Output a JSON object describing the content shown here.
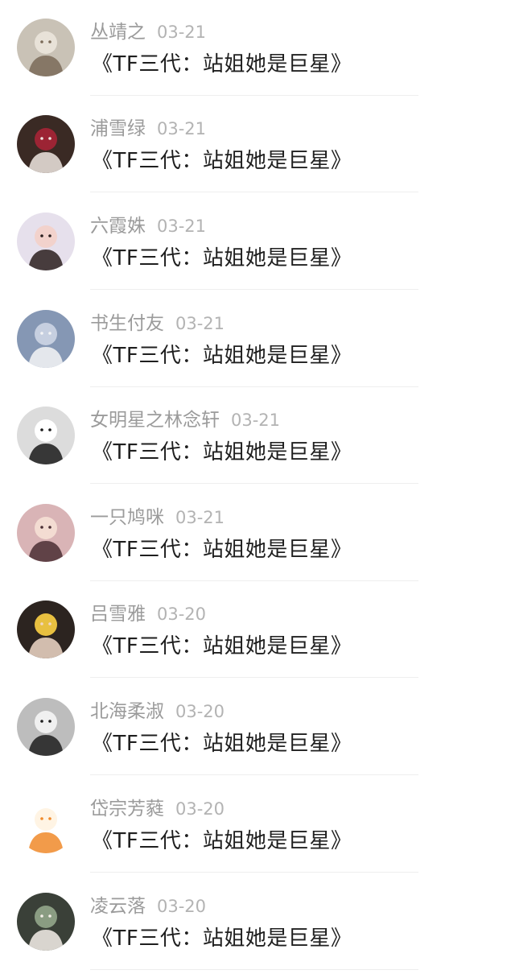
{
  "comments": [
    {
      "user": "丛靖之",
      "date": "03-21",
      "text": "《TF三代：站姐她是巨星》",
      "avatar": {
        "icon": "cat-avatar-icon",
        "bg": "#c9c2b6",
        "fg": "#7a6a58",
        "accent": "#e8e2d8"
      }
    },
    {
      "user": "浦雪绿",
      "date": "03-21",
      "text": "《TF三代：站姐她是巨星》",
      "avatar": {
        "icon": "person-at-table-avatar-icon",
        "bg": "#3a2a24",
        "fg": "#efe6e0",
        "accent": "#9c2434"
      }
    },
    {
      "user": "六霞姝",
      "date": "03-21",
      "text": "《TF三代：站姐她是巨星》",
      "avatar": {
        "icon": "girl-avatar-icon",
        "bg": "#e6e0ec",
        "fg": "#2a1f1f",
        "accent": "#f2d2cc"
      }
    },
    {
      "user": "书生付友",
      "date": "03-21",
      "text": "《TF三代：站姐她是巨星》",
      "avatar": {
        "icon": "night-sky-girl-avatar-icon",
        "bg": "#8597b4",
        "fg": "#f4f4f6",
        "accent": "#c6cfe0"
      }
    },
    {
      "user": "女明星之林念轩",
      "date": "03-21",
      "text": "《TF三代：站姐她是巨星》",
      "avatar": {
        "icon": "girl-white-shirt-avatar-icon",
        "bg": "#dcdcdc",
        "fg": "#1a1a1a",
        "accent": "#ffffff"
      }
    },
    {
      "user": "一只鸠咪",
      "date": "03-21",
      "text": "《TF三代：站姐她是巨星》",
      "avatar": {
        "icon": "anime-girl-avatar-icon",
        "bg": "#d9b4b6",
        "fg": "#4a2e34",
        "accent": "#f3dcd2"
      }
    },
    {
      "user": "吕雪雅",
      "date": "03-20",
      "text": "《TF三代：站姐她是巨星》",
      "avatar": {
        "icon": "girl-glasses-avatar-icon",
        "bg": "#2c2420",
        "fg": "#f0d8c8",
        "accent": "#e8c040"
      }
    },
    {
      "user": "北海柔淑",
      "date": "03-20",
      "text": "《TF三代：站姐她是巨星》",
      "avatar": {
        "icon": "boy-avatar-icon",
        "bg": "#bdbdbd",
        "fg": "#1e1e1e",
        "accent": "#f0f0f0"
      }
    },
    {
      "user": "岱宗芳蕤",
      "date": "03-20",
      "text": "《TF三代：站姐她是巨星》",
      "avatar": {
        "icon": "hamster-avatar-icon",
        "bg": "#ffffff",
        "fg": "#f08a2a",
        "accent": "#fff4e4"
      }
    },
    {
      "user": "凌云落",
      "date": "03-20",
      "text": "《TF三代：站姐她是巨星》",
      "avatar": {
        "icon": "girl-portrait-avatar-icon",
        "bg": "#3a4038",
        "fg": "#f6f0ea",
        "accent": "#8a9c82"
      }
    }
  ]
}
